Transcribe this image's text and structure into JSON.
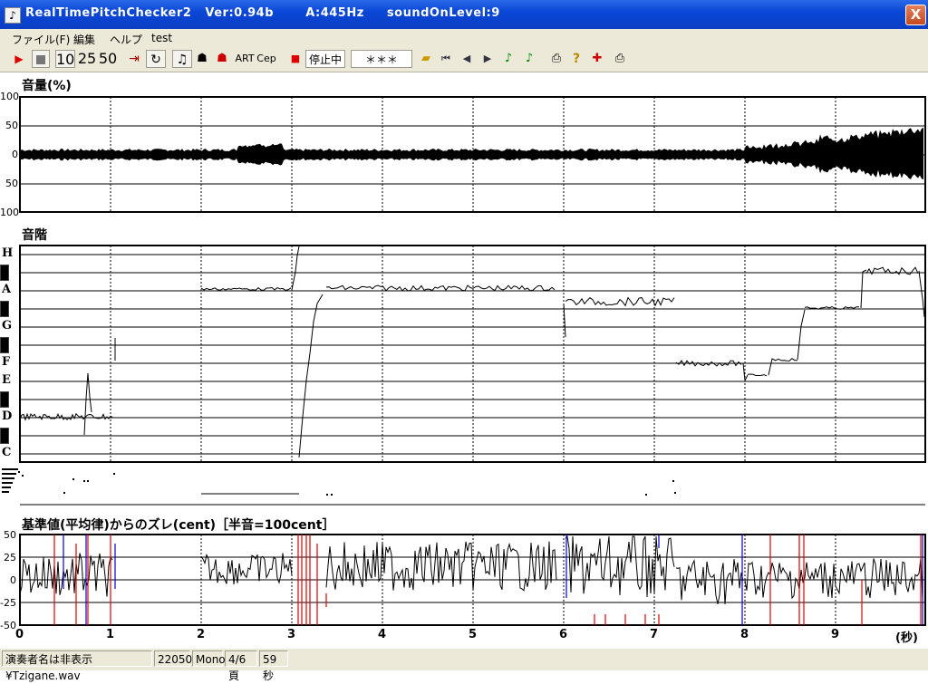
{
  "window": {
    "title": "RealTimePitchChecker2   Ver:0.94b       A:445Hz     soundOnLevel:9",
    "close": "X"
  },
  "menu": [
    "ファイル(F)",
    "編集",
    "ヘルプ",
    "test"
  ],
  "toolbar": {
    "play_icon": "play-icon",
    "stop_icon": "stop-icon",
    "zoom": [
      "10",
      "25",
      "50"
    ],
    "art_label": "ART",
    "cep_label": "Cep",
    "status": "停止中",
    "display": "＊＊＊"
  },
  "panels": {
    "volume": {
      "title": "音量(%)",
      "ticks": [
        "100",
        "50",
        "0",
        "50",
        "100"
      ]
    },
    "pitch": {
      "title": "音階",
      "notes": [
        "H",
        "A",
        "G",
        "F",
        "E",
        "D",
        "C"
      ]
    },
    "deviation": {
      "title": "基準値(平均律)からのズレ(cent)［半音=100cent］",
      "ticks": [
        "50",
        "25",
        "0",
        "-25",
        "-50"
      ]
    }
  },
  "xaxis": {
    "ticks": [
      "0",
      "1",
      "2",
      "3",
      "4",
      "5",
      "6",
      "7",
      "8",
      "9"
    ],
    "unit": "(秒)"
  },
  "statusbar": {
    "file": "演奏者名は非表示¥Tzigane.wav",
    "rate": "22050",
    "channels": "Mono",
    "page": "4/6頁",
    "duration": "59秒"
  },
  "colors": {
    "titlebar": "#0a46d6",
    "chrome": "#ece9d8",
    "red_marker": "#dd0000",
    "blue_marker": "#0000cc"
  }
}
